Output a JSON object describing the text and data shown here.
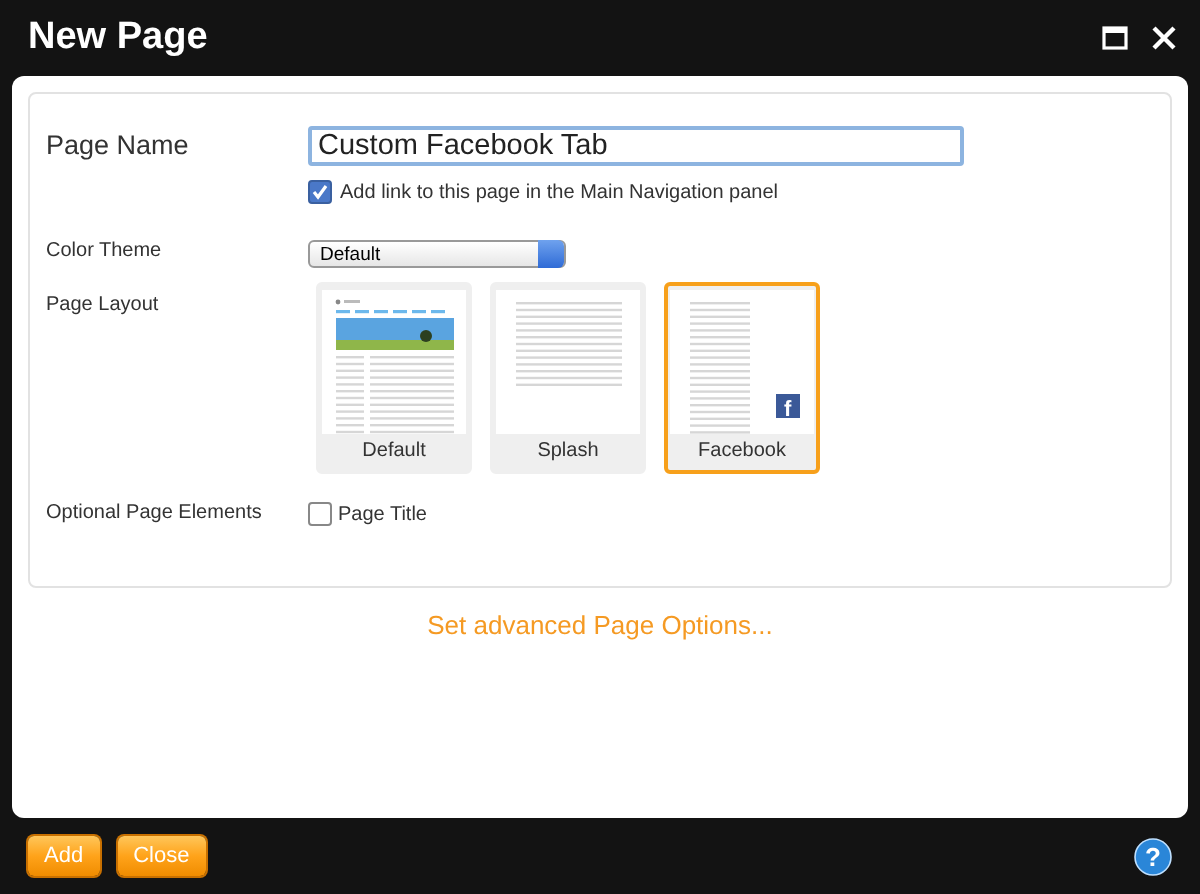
{
  "window": {
    "title": "New Page"
  },
  "form": {
    "page_name": {
      "label": "Page Name",
      "value": "Custom Facebook Tab"
    },
    "nav_link": {
      "label": "Add link to this page in the Main Navigation panel",
      "checked": true
    },
    "color_theme": {
      "label": "Color Theme",
      "value": "Default"
    },
    "page_layout": {
      "label": "Page Layout",
      "options": [
        {
          "kind": "default",
          "label": "Default",
          "selected": false
        },
        {
          "kind": "splash",
          "label": "Splash",
          "selected": false
        },
        {
          "kind": "facebook",
          "label": "Facebook",
          "selected": true,
          "badge": "f"
        }
      ]
    },
    "optional_elements": {
      "label": "Optional Page Elements",
      "options": [
        {
          "label": "Page Title",
          "checked": false
        }
      ]
    }
  },
  "advanced_link": "Set advanced Page Options...",
  "buttons": [
    "Add",
    "Close"
  ],
  "help_button": "?"
}
